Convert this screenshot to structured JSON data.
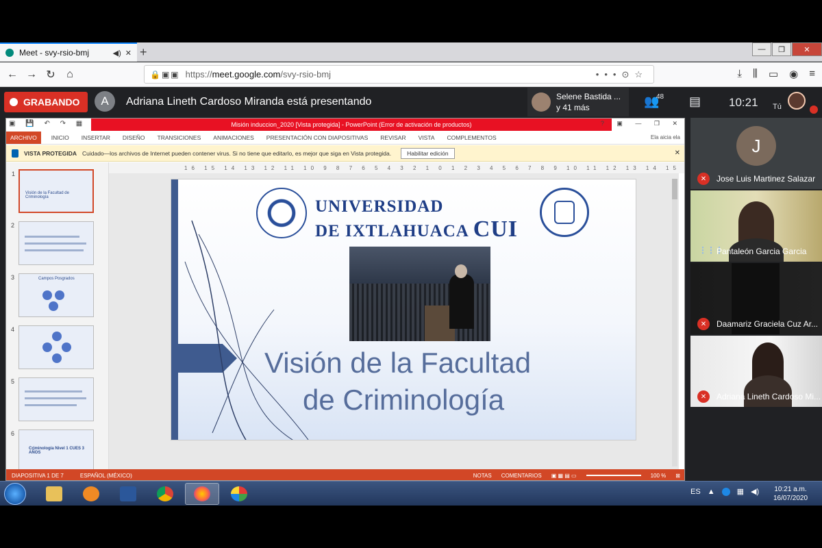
{
  "browser": {
    "tab_title": "Meet - svy-rsio-bmj",
    "url_host": "meet.google.com",
    "url_prefix": "https://",
    "url_path": "/svy-rsio-bmj",
    "new_tab_symbol": "+"
  },
  "meet": {
    "recording_label": "GRABANDO",
    "presenter_initial": "A",
    "presenting_text": "Adriana Lineth Cardoso Miranda está presentando",
    "participant_preview_name": "Selene Bastida ...",
    "participant_preview_more": "y 41 más",
    "participant_count": "48",
    "time": "10:21",
    "self_label": "Tú"
  },
  "powerpoint": {
    "title": "Misión induccion_2020 [Vista protegida] - PowerPoint (Error de activación de productos)",
    "ribbon_tabs": [
      "ARCHIVO",
      "INICIO",
      "INSERTAR",
      "DISEÑO",
      "TRANSICIONES",
      "ANIMACIONES",
      "PRESENTACIÓN CON DIAPOSITIVAS",
      "REVISAR",
      "VISTA",
      "COMPLEMENTOS"
    ],
    "user_label": "Ela aicia ela",
    "protected_view_label": "VISTA PROTEGIDA",
    "protected_view_message": "Cuidado—los archivos de Internet pueden contener virus. Si no tiene que editarlo, es mejor que siga en Vista protegida.",
    "enable_editing_label": "Habilitar edición",
    "ruler_ticks": "16 15 14 13 12 11 10 9 8 7 6 5 4 3 2 1 0 1 2 3 4 5 6 7 8 9 10 11 12 13 14 15 16",
    "thumbnails": [
      {
        "num": "1",
        "text": "Visión de la Facultad de Criminología"
      },
      {
        "num": "2",
        "text": ""
      },
      {
        "num": "3",
        "text": "Campos Posgrados"
      },
      {
        "num": "4",
        "text": ""
      },
      {
        "num": "5",
        "text": ""
      },
      {
        "num": "6",
        "text": "Criminología Nivel 1 CUES 3 AÑOS"
      }
    ],
    "slide": {
      "university_line1": "UNIVERSIDAD",
      "university_line2": "DE IXTLAHUACA",
      "university_line2_cui": "CUI",
      "title_line1": "Visión de la Facultad",
      "title_line2": "de Criminología"
    },
    "status_slide": "DIAPOSITIVA 1 DE 7",
    "status_language": "ESPAÑOL (MÉXICO)",
    "status_notes": "NOTAS",
    "status_comments": "COMENTARIOS",
    "zoom": "100 %"
  },
  "participants": [
    {
      "initial": "J",
      "name": "Jose Luis Martinez Salazar",
      "muted": true
    },
    {
      "initial": "",
      "name": "Pantaleón Garcia Garcia",
      "muted": false
    },
    {
      "initial": "",
      "name": "Daamariz Graciela Cuz Ar...",
      "muted": true
    },
    {
      "initial": "",
      "name": "Adriana Lineth Cardoso Mi...",
      "muted": true
    }
  ],
  "taskbar": {
    "language": "ES",
    "time": "10:21 a.m.",
    "date": "16/07/2020"
  },
  "colors": {
    "recording_red": "#d93025",
    "powerpoint_orange": "#d24726",
    "slide_title_blue": "#566d9b",
    "university_blue": "#1f3e86"
  }
}
